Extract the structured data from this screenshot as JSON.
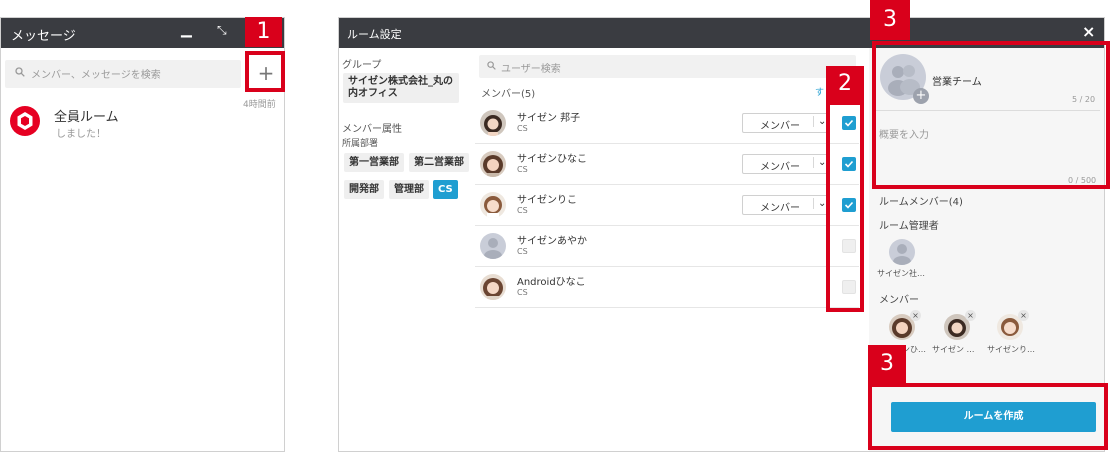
{
  "messages": {
    "title": "メッセージ",
    "minimize_icon": "minimize-icon",
    "shrink_icon": "shrink-icon",
    "search_placeholder": "メンバー、メッセージを検索",
    "add_symbol": "+",
    "rooms": [
      {
        "name": "全員ルーム",
        "preview": "しました！",
        "time": "4時間前"
      }
    ]
  },
  "dialog": {
    "title": "ルーム設定",
    "close_symbol": "×",
    "group_heading": "グループ",
    "group_name": "サイゼン株式会社_丸の内オフィス",
    "attribute_heading": "メンバー属性",
    "department_heading": "所属部署",
    "departments": [
      "第一営業部",
      "第二営業部",
      "開発部",
      "管理部",
      "CS"
    ],
    "selected_department": "CS",
    "user_search_placeholder": "ユーザー検索",
    "members_label": "メンバー(5)",
    "select_all_fragment": "す",
    "members": [
      {
        "name": "サイゼン 邦子",
        "dept": "CS",
        "role": "メンバー",
        "checked": true
      },
      {
        "name": "サイゼンひなこ",
        "dept": "CS",
        "role": "メンバー",
        "checked": true
      },
      {
        "name": "サイゼンりこ",
        "dept": "CS",
        "role": "メンバー",
        "checked": true
      },
      {
        "name": "サイゼンあやか",
        "dept": "CS",
        "role": "",
        "checked": false
      },
      {
        "name": "Androidひなこ",
        "dept": "CS",
        "role": "",
        "checked": false
      }
    ],
    "room_name": "営業チーム",
    "room_name_count": "5 / 20",
    "description_placeholder": "概要を入力",
    "description_count": "0 / 500",
    "room_members_heading": "ルームメンバー(4)",
    "room_admin_heading": "ルーム管理者",
    "admin_name": "サイゼン社…",
    "member_heading": "メンバー",
    "room_members": [
      "サイゼンひ…",
      "サイゼン …",
      "サイゼンり…"
    ],
    "remove_symbol": "×",
    "create_button": "ルームを作成"
  },
  "callouts": [
    "1",
    "2",
    "3",
    "3"
  ],
  "colors": {
    "header": "#3a3c41",
    "accent": "#1f9ed1",
    "callout": "#d9001b",
    "logo": "#e60022"
  }
}
